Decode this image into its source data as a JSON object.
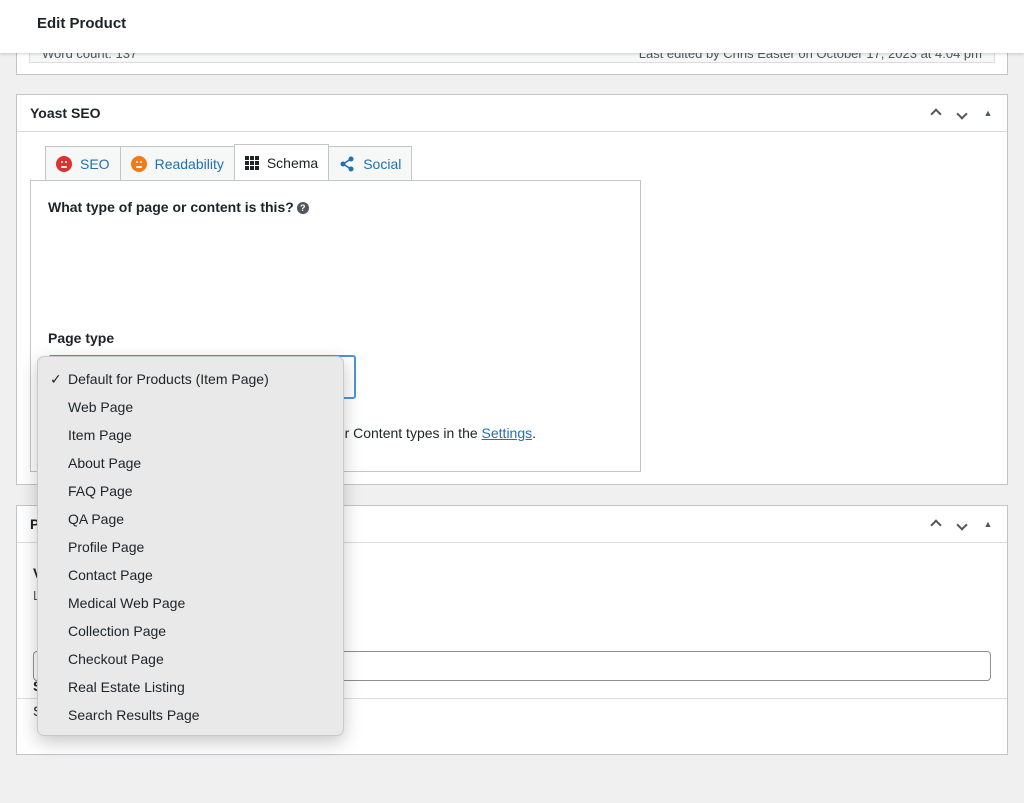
{
  "header": {
    "title": "Edit Product"
  },
  "word_count_bar": {
    "left": "Word count: 137",
    "right": "Last edited by Chris Easter on October 17, 2023 at 4:04 pm"
  },
  "yoast": {
    "title": "Yoast SEO",
    "tabs": [
      {
        "label": "SEO",
        "icon": "red-face-icon"
      },
      {
        "label": "Readability",
        "icon": "orange-face-icon"
      },
      {
        "label": "Schema",
        "icon": "grid-icon"
      },
      {
        "label": "Social",
        "icon": "share-icon"
      }
    ],
    "schema": {
      "question": "What type of page or content is this?",
      "help_glyph": "?",
      "page_type_label": "Page type",
      "description_prefix": "der Content types in the ",
      "settings_link": "Settings",
      "description_suffix": "."
    }
  },
  "second_box": {
    "title_fragment": "P",
    "frag_v": "V",
    "frag_l": "L",
    "frag_s1": "S",
    "frag_s2": "S"
  },
  "dropdown": {
    "selected": "Default for Products (Item Page)",
    "check_glyph": "✓",
    "options": [
      "Default for Products (Item Page)",
      "Web Page",
      "Item Page",
      "About Page",
      "FAQ Page",
      "QA Page",
      "Profile Page",
      "Contact Page",
      "Medical Web Page",
      "Collection Page",
      "Checkout Page",
      "Real Estate Listing",
      "Search Results Page"
    ]
  }
}
